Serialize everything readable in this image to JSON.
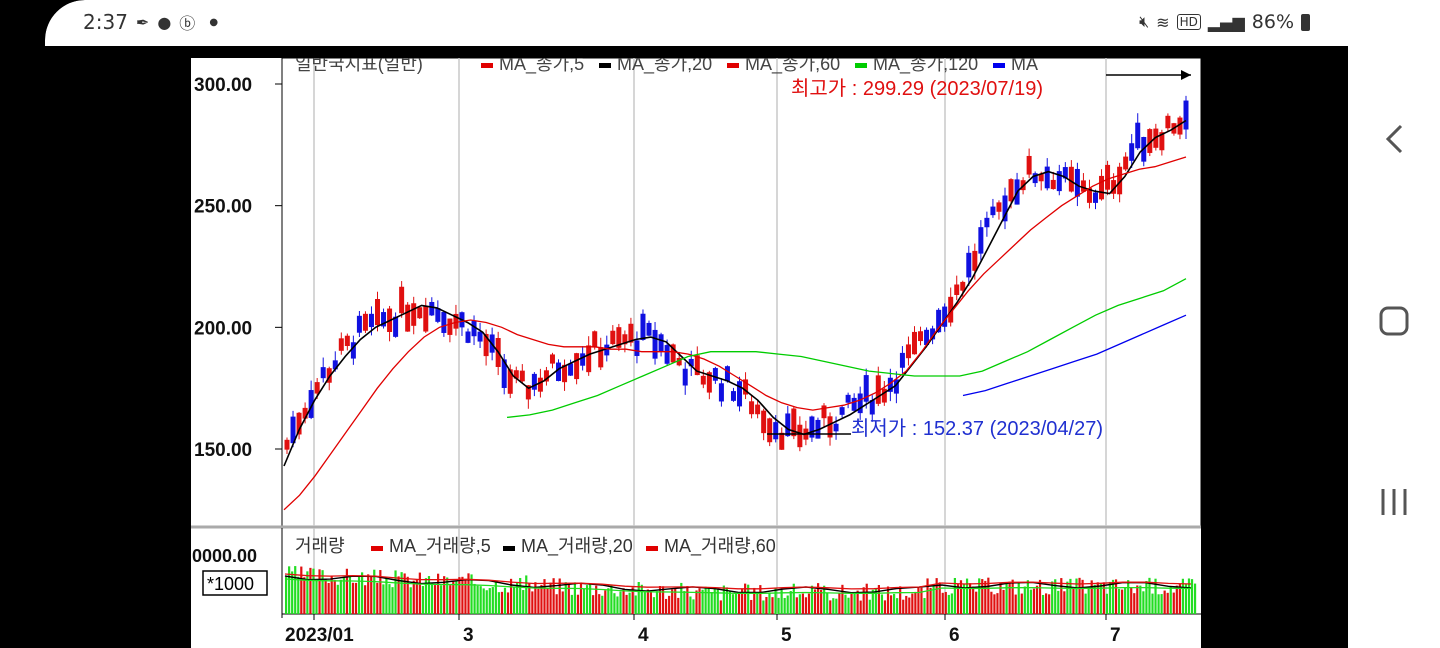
{
  "status_bar": {
    "time": "2:37",
    "left_icons": [
      "feather-icon",
      "chat-bubble-icon",
      "b-app-icon",
      "dot-icon"
    ],
    "battery": "86%",
    "right_icons": [
      "mute-icon",
      "wifi-icon",
      "hd-icon",
      "signal-icon",
      "battery-icon"
    ]
  },
  "nav_bar": {
    "buttons": [
      "back-icon",
      "home-icon",
      "recents-icon"
    ]
  },
  "chart_data": [
    {
      "type": "line",
      "legend_header": "일반국지표(일반)",
      "legend": [
        {
          "name": "MA_종가,5",
          "color": "#e00000"
        },
        {
          "name": "MA_종가,20",
          "color": "#000000"
        },
        {
          "name": "MA_종가,60",
          "color": "#e00000"
        },
        {
          "name": "MA_종가,120",
          "color": "#00cc00"
        },
        {
          "name": "MA",
          "color": "#0000ee"
        }
      ],
      "y_ticks": [
        "300.00",
        "250.00",
        "200.00",
        "150.00"
      ],
      "ylim": [
        120,
        305
      ],
      "x_ticks": [
        "2023/01",
        "3",
        "4",
        "5",
        "6",
        "7"
      ],
      "annotations": {
        "high": "최고가 : 299.29 (2023/07/19)",
        "low": "최저가 : 152.37 (2023/04/27)"
      },
      "series": [
        {
          "name": "MA_종가,5",
          "color": "#000000",
          "values": [
            143,
            158,
            170,
            180,
            188,
            195,
            200,
            203,
            206,
            209,
            208,
            205,
            202,
            198,
            190,
            180,
            175,
            178,
            183,
            186,
            189,
            191,
            193,
            195,
            196,
            194,
            188,
            182,
            180,
            178,
            175,
            170,
            163,
            158,
            156,
            158,
            161,
            164,
            168,
            172,
            176,
            184,
            192,
            201,
            210,
            220,
            232,
            244,
            256,
            262,
            264,
            262,
            258,
            256,
            255,
            262,
            272,
            278,
            281,
            285
          ]
        },
        {
          "name": "MA_종가,20",
          "color": "#e00000",
          "values": [
            125,
            131,
            139,
            148,
            157,
            166,
            175,
            183,
            190,
            196,
            200,
            202,
            203,
            202,
            200,
            197,
            195,
            193,
            192,
            192,
            192,
            191,
            191,
            190,
            190,
            190,
            189,
            187,
            184,
            180,
            176,
            172,
            169,
            167,
            166,
            167,
            168,
            170,
            173,
            177,
            182,
            190,
            199,
            207,
            215,
            222,
            228,
            234,
            240,
            245,
            250,
            254,
            258,
            261,
            263,
            265,
            266,
            268,
            270
          ]
        },
        {
          "name": "MA_종가,60",
          "color": "#00cc00",
          "values": [
            163,
            164,
            166,
            169,
            172,
            176,
            180,
            184,
            188,
            190,
            190,
            190,
            189,
            188,
            186,
            184,
            182,
            181,
            180,
            180,
            180,
            182,
            186,
            190,
            195,
            200,
            205,
            209,
            212,
            215,
            220
          ]
        },
        {
          "name": "MA_종가,120",
          "color": "#0000ee",
          "values": [
            172,
            174,
            177,
            180,
            183,
            186,
            189,
            193,
            197,
            201,
            205
          ]
        }
      ]
    },
    {
      "type": "bar",
      "title": "거래량",
      "legend": [
        {
          "name": "MA_거래량,5",
          "color": "#e00000"
        },
        {
          "name": "MA_거래량,20",
          "color": "#000000"
        },
        {
          "name": "MA_거래량,60",
          "color": "#e00000"
        }
      ],
      "y_ticks": [
        "0000.00"
      ],
      "scale_label": "*1000"
    }
  ]
}
